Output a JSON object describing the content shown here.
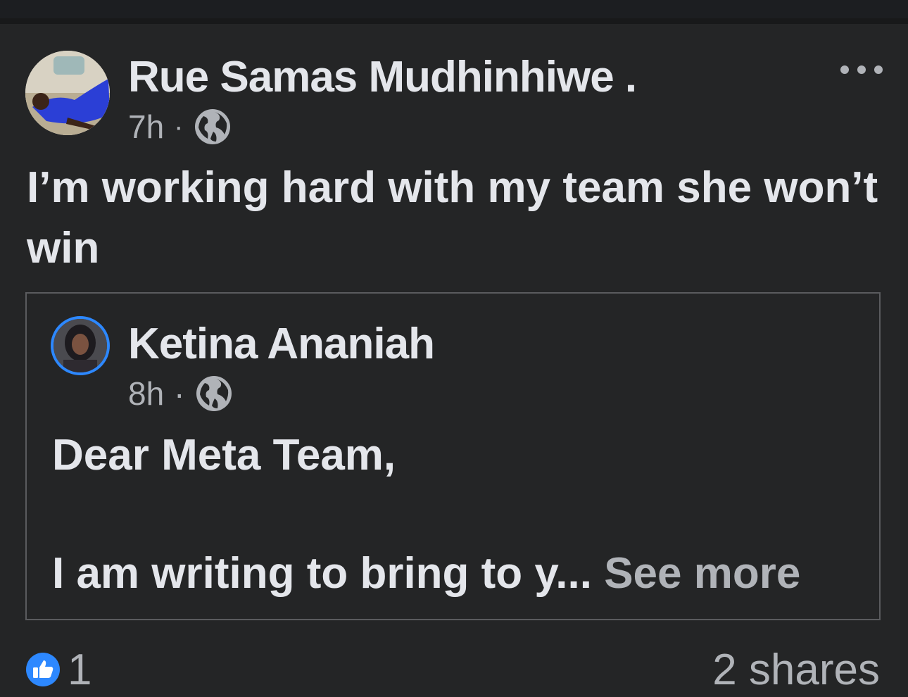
{
  "post": {
    "author": "Rue Samas Mudhinhiwe .",
    "time": "7h",
    "separator": "·",
    "privacy_icon": "globe-icon",
    "text": "I’m working hard with my team she won’t win",
    "menu_icon": "more-options-icon"
  },
  "shared": {
    "author": "Ketina Ananiah",
    "time": "8h",
    "separator": "·",
    "privacy_icon": "globe-icon",
    "line1": "Dear Meta Team,",
    "line2": "I am writing to bring to y...",
    "see_more": "See more"
  },
  "footer": {
    "reaction_icon": "like-reaction-icon",
    "likes": "1",
    "shares": "2 shares"
  },
  "colors": {
    "background": "#242526",
    "primary_text": "#e4e6eb",
    "secondary_text": "#b0b3b8",
    "accent": "#2d88ff"
  }
}
